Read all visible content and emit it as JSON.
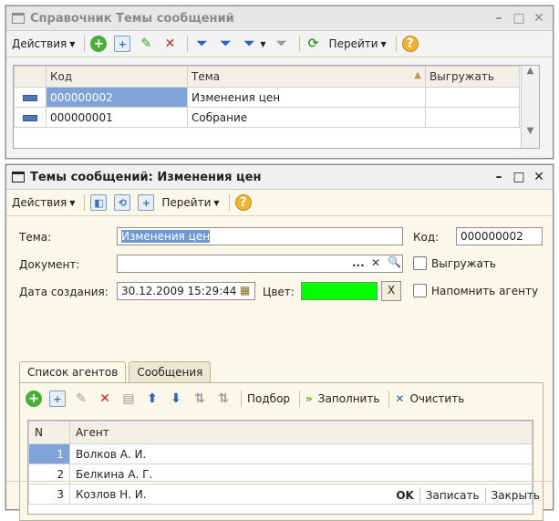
{
  "win1": {
    "title": "Справочник Темы сообщений",
    "toolbar": {
      "actions": "Действия",
      "goto": "Перейти"
    },
    "columns": [
      "Код",
      "Тема",
      "Выгружать"
    ],
    "rows": [
      {
        "code": "000000002",
        "topic": "Изменения цен",
        "export": ""
      },
      {
        "code": "000000001",
        "topic": "Собрание",
        "export": ""
      }
    ]
  },
  "win2": {
    "title": "Темы сообщений: Изменения цен",
    "toolbar": {
      "actions": "Действия",
      "goto": "Перейти"
    },
    "form": {
      "topic_label": "Тема:",
      "topic_value": "Изменения цен",
      "code_label": "Код:",
      "code_value": "000000002",
      "document_label": "Документ:",
      "document_value": "",
      "export_label": "Выгружать",
      "date_label": "Дата создания:",
      "date_value": "30.12.2009 15:29:44",
      "color_label": "Цвет:",
      "color_clear": "X",
      "remind_label": "Напомнить агенту",
      "doc_dots": "..."
    },
    "tabs": [
      "Список агентов",
      "Сообщения"
    ],
    "agents_toolbar": {
      "pick": "Подбор",
      "fill": "Заполнить",
      "clear": "Очистить"
    },
    "agents_columns": [
      "N",
      "Агент"
    ],
    "agents": [
      {
        "n": "1",
        "name": "Волков А. И."
      },
      {
        "n": "2",
        "name": "Белкина А. Г."
      },
      {
        "n": "3",
        "name": "Козлов Н. И."
      }
    ],
    "buttons": {
      "ok": "OK",
      "save": "Записать",
      "close": "Закрыть"
    }
  },
  "colors": {
    "color_swatch": "#00ff00",
    "selection": "#7fa3d6",
    "accent_green": "#4cae3a"
  }
}
